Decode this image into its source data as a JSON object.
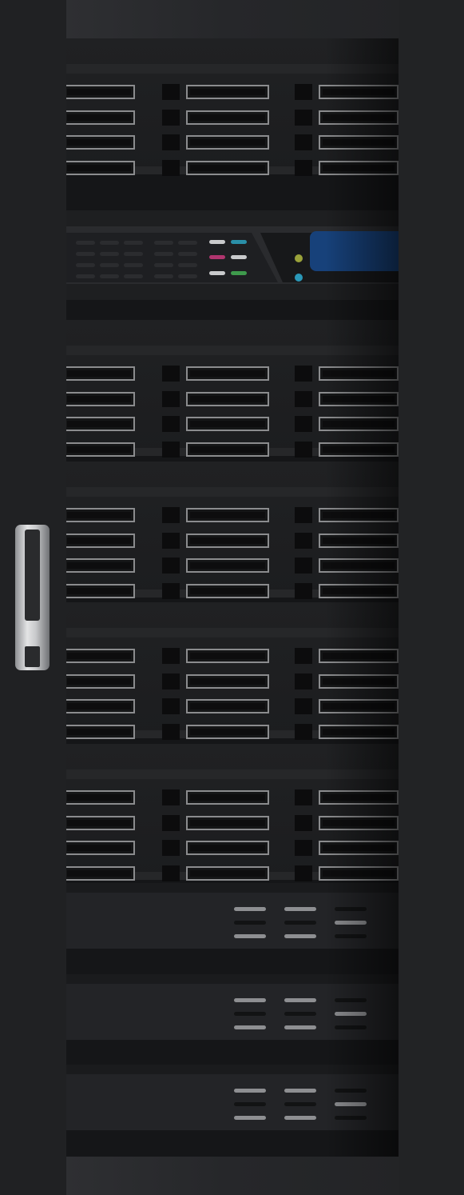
{
  "colors": {
    "bay_background": "#151618",
    "door": "#202123",
    "handle": "#c8c9cb",
    "caddy_border": "#8b8c8e",
    "lcd": "#17417a",
    "led_yellow": "#9aa23a",
    "led_cyan": "#2a98b8",
    "pill_white": "#c9cacc",
    "pill_teal": "#2a8fa8",
    "pill_magenta": "#b0356e",
    "pill_green": "#3e9a4c",
    "vent_light": "#8e8f92",
    "vent_dark": "#2b2c2f"
  },
  "icons": {
    "handle": "door-handle-icon",
    "lcd": "lcd-display-icon",
    "led": "status-led-icon",
    "drive": "drive-caddy-icon",
    "vent": "vent-icon"
  },
  "rack": {
    "drive_units": 5,
    "drives_per_row": 3,
    "rows_per_unit": 4,
    "control_panel_units": 1,
    "blank_units": 3
  }
}
